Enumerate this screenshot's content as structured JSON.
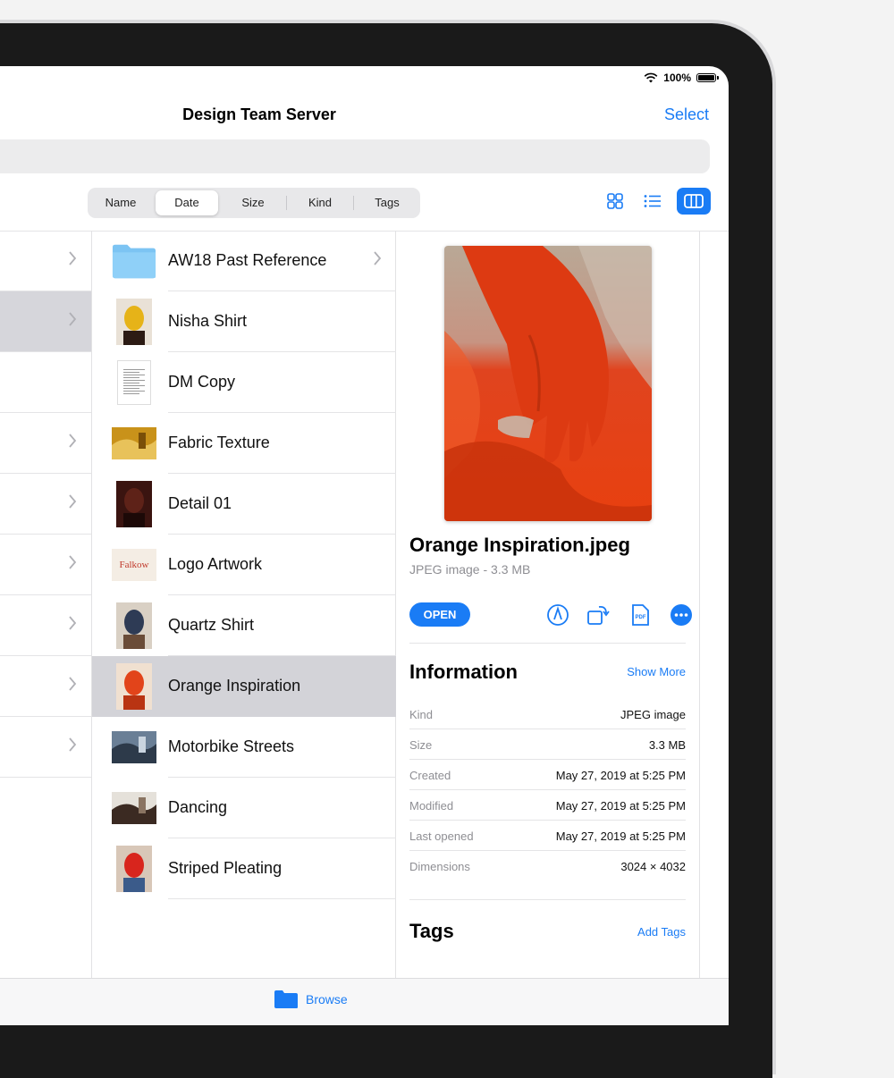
{
  "status_bar": {
    "battery": "100%"
  },
  "nav": {
    "title": "Design Team Server",
    "select_label": "Select"
  },
  "sort_options": [
    "Name",
    "Date",
    "Size",
    "Kind",
    "Tags"
  ],
  "selected_sort": "Date",
  "view_modes": [
    "icons-view-icon",
    "list-view-icon",
    "columns-view-icon"
  ],
  "files": [
    {
      "name": "AW18 Past Reference",
      "thumb": "folder-icon"
    },
    {
      "name": "Nisha Shirt",
      "thumb": "photo-thumbnail"
    },
    {
      "name": "DM Copy",
      "thumb": "document-thumbnail"
    },
    {
      "name": "Fabric Texture",
      "thumb": "photo-thumbnail"
    },
    {
      "name": "Detail 01",
      "thumb": "photo-thumbnail"
    },
    {
      "name": "Logo Artwork",
      "thumb": "logo-thumbnail",
      "thumb_text": "Falkow"
    },
    {
      "name": "Quartz Shirt",
      "thumb": "photo-thumbnail"
    },
    {
      "name": "Orange Inspiration",
      "thumb": "photo-thumbnail",
      "selected": true
    },
    {
      "name": "Motorbike Streets",
      "thumb": "photo-thumbnail"
    },
    {
      "name": "Dancing",
      "thumb": "photo-thumbnail"
    },
    {
      "name": "Striped Pleating",
      "thumb": "photo-thumbnail"
    }
  ],
  "preview": {
    "title": "Orange Inspiration.jpeg",
    "subtitle": "JPEG image - 3.3 MB",
    "open_label": "OPEN",
    "actions": [
      "markup-icon",
      "rotate-icon",
      "pdf-icon",
      "more-icon"
    ],
    "info_title": "Information",
    "show_more": "Show More",
    "info": [
      {
        "key": "Kind",
        "value": "JPEG image"
      },
      {
        "key": "Size",
        "value": "3.3 MB"
      },
      {
        "key": "Created",
        "value": "May 27, 2019 at 5:25 PM"
      },
      {
        "key": "Modified",
        "value": "May 27, 2019 at 5:25 PM"
      },
      {
        "key": "Last opened",
        "value": "May 27, 2019 at 5:25 PM"
      },
      {
        "key": "Dimensions",
        "value": "3024 × 4032"
      }
    ],
    "tags_title": "Tags",
    "add_tags": "Add Tags"
  },
  "tabbar": {
    "browse_label": "Browse"
  },
  "colors": {
    "accent": "#1a7cf5",
    "selection": "#d3d3d8"
  }
}
